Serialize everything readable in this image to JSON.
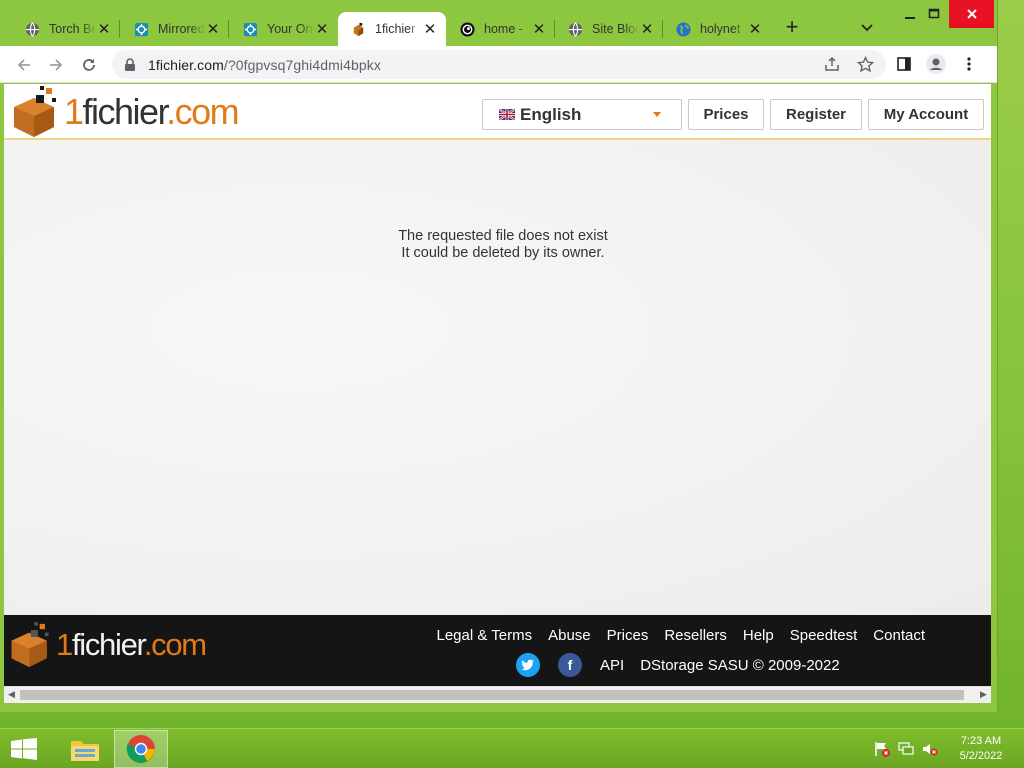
{
  "browser": {
    "tabs": [
      {
        "label": "Torch Browser",
        "icon": "globe-icon"
      },
      {
        "label": "Mirrored",
        "icon": "network-icon"
      },
      {
        "label": "Your Online",
        "icon": "network-icon"
      },
      {
        "label": "1fichier",
        "icon": "fichier-box-icon",
        "active": true
      },
      {
        "label": "home - ",
        "icon": "spiral-icon"
      },
      {
        "label": "Site Blocked",
        "icon": "globe-icon"
      },
      {
        "label": "holynet",
        "icon": "earth-icon"
      }
    ],
    "url_host": "1fichier.com",
    "url_path": "/?0fgpvsq7ghi4dmi4bpkx"
  },
  "site": {
    "logo": {
      "part1": "1",
      "part2": "fichier",
      "part3": ".com"
    },
    "language": "English",
    "nav": {
      "prices": "Prices",
      "register": "Register",
      "account": "My Account"
    }
  },
  "message": {
    "line1": "The requested file does not exist",
    "line2": "It could be deleted by its owner."
  },
  "footer": {
    "links": [
      "Legal & Terms",
      "Abuse",
      "Prices",
      "Resellers",
      "Help",
      "Speedtest",
      "Contact"
    ],
    "api": "API",
    "copyright": "DStorage SASU © 2009-2022"
  },
  "taskbar": {
    "time": "7:23 AM",
    "date": "5/2/2022"
  },
  "colors": {
    "brand_orange": "#e07b1a",
    "footer_bg": "#151515",
    "desktop_green": "#8dc63f"
  }
}
